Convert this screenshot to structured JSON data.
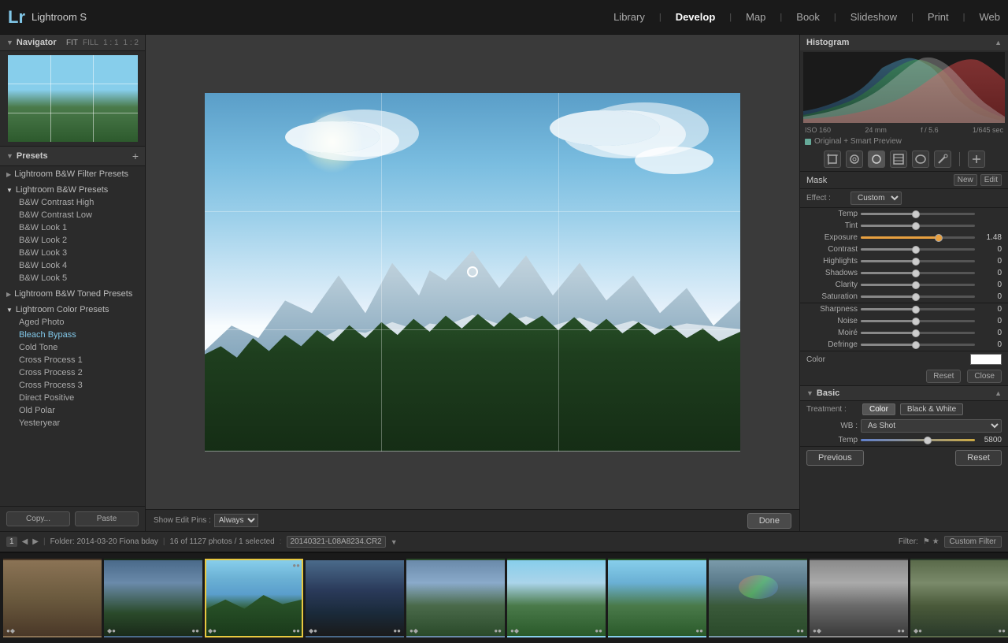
{
  "app": {
    "logo": "Lr",
    "title": "Lightroom S"
  },
  "nav": {
    "items": [
      "Library",
      "Develop",
      "Map",
      "Book",
      "Slideshow",
      "Print",
      "Web"
    ],
    "active": "Develop",
    "separators": [
      "|",
      "|",
      "|",
      "|",
      "|",
      "|"
    ]
  },
  "navigator": {
    "title": "Navigator",
    "controls": [
      "FIT",
      "FILL",
      "1:1",
      "1:2"
    ]
  },
  "presets": {
    "title": "Presets",
    "groups": [
      {
        "name": "Lightroom B&W Filter Presets",
        "expanded": false,
        "items": []
      },
      {
        "name": "Lightroom B&W Presets",
        "expanded": true,
        "items": [
          "B&W Contrast High",
          "B&W Contrast Low",
          "B&W Look 1",
          "B&W Look 2",
          "B&W Look 3",
          "B&W Look 4",
          "B&W Look 5"
        ]
      },
      {
        "name": "Lightroom B&W Toned Presets",
        "expanded": false,
        "items": []
      },
      {
        "name": "Lightroom Color Presets",
        "expanded": true,
        "items": [
          "Aged Photo",
          "Bleach Bypass",
          "Cold Tone",
          "Cross Process 1",
          "Cross Process 2",
          "Cross Process 3",
          "Direct Positive",
          "Old Polar",
          "Yesteryear"
        ]
      }
    ],
    "buttons": {
      "copy": "Copy...",
      "paste": "Paste"
    }
  },
  "bottom_edit_bar": {
    "show_edit_pins": "Show Edit Pins :",
    "pins_value": "Always",
    "done": "Done"
  },
  "histogram": {
    "title": "Histogram",
    "iso": "ISO 160",
    "focal": "24 mm",
    "aperture": "f / 5.6",
    "shutter": "1/645 sec",
    "preview_label": "Original + Smart Preview"
  },
  "tools": [
    {
      "name": "crop-tool",
      "icon": "⊡"
    },
    {
      "name": "spot-removal",
      "icon": "◎"
    },
    {
      "name": "red-eye",
      "icon": "○"
    },
    {
      "name": "gradient-filter",
      "icon": "▭"
    },
    {
      "name": "radial-filter",
      "icon": "◯"
    },
    {
      "name": "adjustment-brush",
      "icon": "—"
    }
  ],
  "mask": {
    "label": "Mask",
    "new_btn": "New",
    "edit_btn": "Edit"
  },
  "effect": {
    "label": "Effect :",
    "value": "Custom"
  },
  "sliders": {
    "temp": {
      "label": "Temp",
      "value": "",
      "position": 50
    },
    "tint": {
      "label": "Tint",
      "value": "",
      "position": 50
    },
    "exposure": {
      "label": "Exposure",
      "value": "1.48",
      "position": 72
    },
    "contrast": {
      "label": "Contrast",
      "value": "0",
      "position": 50
    },
    "highlights": {
      "label": "Highlights",
      "value": "0",
      "position": 50
    },
    "shadows": {
      "label": "Shadows",
      "value": "0",
      "position": 50
    },
    "clarity": {
      "label": "Clarity",
      "value": "0",
      "position": 50
    },
    "saturation": {
      "label": "Saturation",
      "value": "0",
      "position": 50
    },
    "sharpness": {
      "label": "Sharpness",
      "value": "0",
      "position": 50
    },
    "noise": {
      "label": "Noise",
      "value": "0",
      "position": 50
    },
    "moire": {
      "label": "Moiré",
      "value": "0",
      "position": 50
    },
    "defringe": {
      "label": "Defringe",
      "value": "0",
      "position": 50
    }
  },
  "color": {
    "label": "Color",
    "swatch_bg": "#ffffff"
  },
  "actions": {
    "reset": "Reset",
    "close": "Close"
  },
  "basic": {
    "title": "Basic",
    "expand_icon": "▶"
  },
  "treatment": {
    "label": "Treatment :",
    "color_btn": "Color",
    "bw_btn": "Black & White"
  },
  "wb": {
    "label": "WB :",
    "value": "As Shot",
    "temp_value": "5800"
  },
  "prev_reset": {
    "previous": "Previous",
    "reset": "Reset"
  },
  "folder_info": {
    "folder": "Folder: 2014-03-20 Fiona bday",
    "count": "16 of 1127 photos / 1 selected",
    "filename": "20140321-L08A8234.CR2"
  },
  "filter": {
    "label": "Filter:",
    "custom": "Custom Filter"
  },
  "filmstrip": {
    "thumbnails": [
      {
        "id": 1,
        "bg": "linear-gradient(180deg,#8B7355 0%,#6B5A3E 50%,#4a3828 100%)",
        "selected": false
      },
      {
        "id": 2,
        "bg": "linear-gradient(180deg,#4a6a8a 0%,#6a8aaa 30%,#2a4a2a 70%,#1a2a1a 100%)",
        "selected": false
      },
      {
        "id": 3,
        "bg": "linear-gradient(180deg,#87CEEB 0%,#6ab0d4 30%,#8dc8e8 50%,#2d5a2d 70%,#1a3a1a 100%)",
        "selected": true
      },
      {
        "id": 4,
        "bg": "linear-gradient(180deg,#4a6a8a 0%,#2a3a5a 40%,#1a2a3a 70%,#1a1a1a 100%)",
        "selected": false
      },
      {
        "id": 5,
        "bg": "linear-gradient(180deg,#6a8aaa 0%,#8aaaca 30%,#4a6a4a 60%,#2a4a2a 100%)",
        "selected": false
      },
      {
        "id": 6,
        "bg": "linear-gradient(180deg,#87CEEB 0%,#aad4ea 30%,#4a7a4a 60%,#2a5a2a 100%)",
        "selected": false
      },
      {
        "id": 7,
        "bg": "linear-gradient(180deg,#87CEEB 0%,#6ab0d4 30%,#4a7a4a 60%,#2a5a2a 100%)",
        "selected": false
      },
      {
        "id": 8,
        "bg": "linear-gradient(180deg,#6a8aaa 0%,#4a6a8a 40%,#3a5a3a 70%,#1a3a1a 100%)",
        "selected": false
      },
      {
        "id": 9,
        "bg": "linear-gradient(180deg,#6a9aaa 0%,#4a7a8a 30%,#2a5a2a 60%,#8a6a2a 100%)",
        "selected": false
      },
      {
        "id": 10,
        "bg": "linear-gradient(180deg,#8a8a8a 0%,#aaaaaa 30%,#5a5a5a 60%,#3a3a3a 100%)",
        "selected": false
      }
    ]
  }
}
